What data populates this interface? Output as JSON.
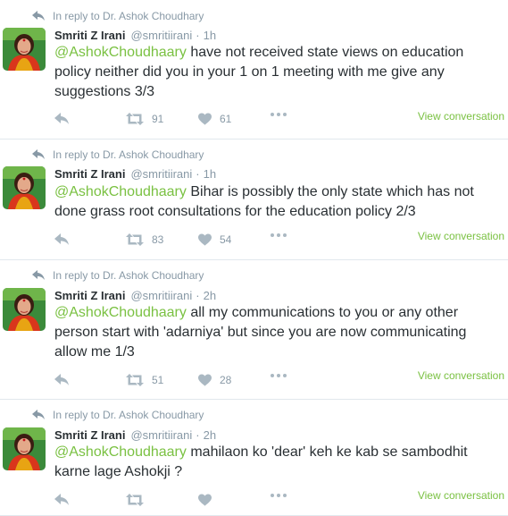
{
  "theme": {
    "link_color": "#7ac142",
    "muted_color": "#8899a6",
    "border_color": "#e1e8ed"
  },
  "icons": {
    "reply_context": "reply-arrow-icon",
    "reply": "reply-icon",
    "retweet": "retweet-icon",
    "like": "heart-icon",
    "more": "more-dots-icon"
  },
  "tweets": [
    {
      "reply_context": "In reply to Dr. Ashok Choudhary",
      "author": {
        "name": "Smriti Z Irani",
        "handle": "@smritiirani"
      },
      "separator": "·",
      "time": "1h",
      "mention": "@AshokChoudhaary",
      "text": " have not received state views on education policy neither did you in your 1 on 1 meeting with me give any suggestions 3/3",
      "retweets": "91",
      "likes": "61",
      "view_conversation": "View conversation"
    },
    {
      "reply_context": "In reply to Dr. Ashok Choudhary",
      "author": {
        "name": "Smriti Z Irani",
        "handle": "@smritiirani"
      },
      "separator": "·",
      "time": "1h",
      "mention": "@AshokChoudhaary",
      "text": " Bihar is possibly the only state which has not done grass root consultations for the education policy 2/3",
      "retweets": "83",
      "likes": "54",
      "view_conversation": "View conversation"
    },
    {
      "reply_context": "In reply to Dr. Ashok Choudhary",
      "author": {
        "name": "Smriti Z Irani",
        "handle": "@smritiirani"
      },
      "separator": "·",
      "time": "2h",
      "mention": "@AshokChoudhaary",
      "text": " all my communications to you or any other person start with 'adarniya' but since you are now communicating allow me 1/3",
      "retweets": "51",
      "likes": "28",
      "view_conversation": "View conversation"
    },
    {
      "reply_context": "In reply to Dr. Ashok Choudhary",
      "author": {
        "name": "Smriti Z Irani",
        "handle": "@smritiirani"
      },
      "separator": "·",
      "time": "2h",
      "mention": "@AshokChoudhaary",
      "text": " mahilaon ko 'dear' keh ke kab se sambodhit karne lage Ashokji ?",
      "retweets": "",
      "likes": "",
      "view_conversation": "View conversation"
    }
  ]
}
